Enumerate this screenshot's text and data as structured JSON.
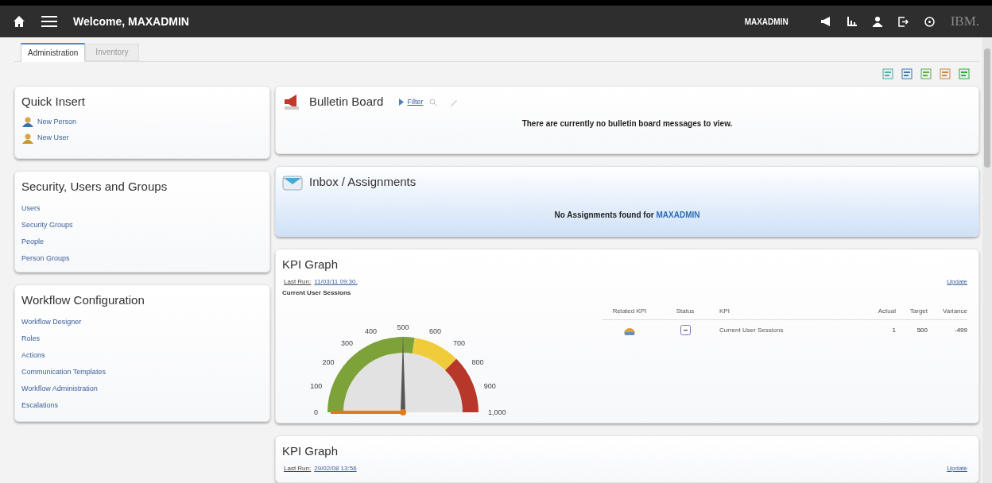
{
  "header": {
    "title": "Welcome, MAXADMIN",
    "user": "MAXADMIN",
    "brand": "IBM."
  },
  "tabs": [
    {
      "label": "Administration",
      "selected": true
    },
    {
      "label": "Inventory",
      "selected": false
    }
  ],
  "quick_insert": {
    "title": "Quick Insert",
    "items": [
      {
        "label": "New Person",
        "kind": "person"
      },
      {
        "label": "New User",
        "kind": "user"
      }
    ]
  },
  "security": {
    "title": "Security, Users and Groups",
    "links": [
      "Users",
      "Security Groups",
      "People",
      "Person Groups"
    ]
  },
  "workflow": {
    "title": "Workflow Configuration",
    "links": [
      "Workflow Designer",
      "Roles",
      "Actions",
      "Communication Templates",
      "Workflow Administration",
      "Escalations"
    ]
  },
  "bulletin": {
    "title": "Bulletin Board",
    "filter": "Filter",
    "message": "There are currently no bulletin board messages to view."
  },
  "inbox": {
    "title": "Inbox / Assignments",
    "message": "No Assignments found for ",
    "user": "MAXADMIN"
  },
  "kpi_graphs": [
    {
      "title": "KPI Graph",
      "last_run_label": "Last Run:",
      "last_run": "11/03/11 09:30.",
      "update": "Update",
      "gauge_title": "Current User Sessions",
      "gauge": {
        "ticks": [
          "0",
          "100",
          "200",
          "300",
          "400",
          "500",
          "600",
          "700",
          "800",
          "900",
          "1,000"
        ]
      },
      "columns": [
        "Related KPI",
        "Status",
        "KPI",
        "Actual",
        "Target",
        "Variance"
      ],
      "rows": [
        {
          "kpi": "Current User Sessions",
          "actual": "1",
          "target": "500",
          "variance": "-499"
        }
      ]
    },
    {
      "title": "KPI Graph",
      "last_run_label": "Last Run:",
      "last_run": "29/02/08 13:56",
      "update": "Update"
    }
  ]
}
